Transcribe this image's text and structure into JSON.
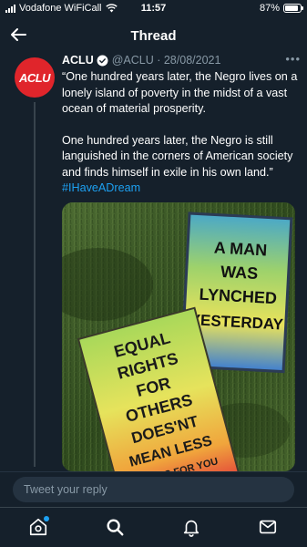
{
  "status_bar": {
    "carrier": "Vodafone WiFiCall",
    "time": "11:57",
    "battery": "87%",
    "battery_level": 0.87
  },
  "header": {
    "title": "Thread"
  },
  "tweet": {
    "avatar_text": "ACLU",
    "display_name": "ACLU",
    "handle_date": "@ACLU · 28/08/2021",
    "paragraph1": "“One hundred years later, the Negro lives on a lonely island of poverty in the midst of a vast ocean of material prosperity.",
    "paragraph2_text": "One hundred years later, the Negro is still languished in the corners of American society and finds himself in exile in his own land.” ",
    "hashtag": "#IHaveADream",
    "colors": {
      "avatar_bg": "#e0252b",
      "verified": "#1da1f2",
      "link": "#1da1f2"
    }
  },
  "media": {
    "sign1_lines": [
      "A MAN",
      "WAS",
      "LYNCHED",
      "YESTERDAY"
    ],
    "sign2_lines": [
      "EQUAL",
      "RIGHTS",
      "FOR",
      "OTHERS",
      "DOES'NT",
      "MEAN LESS",
      "RIGHTS FOR YOU"
    ]
  },
  "reply": {
    "placeholder": "Tweet your reply"
  },
  "nav": {
    "items": [
      "home-icon",
      "search-icon",
      "notifications-icon",
      "messages-icon"
    ]
  }
}
